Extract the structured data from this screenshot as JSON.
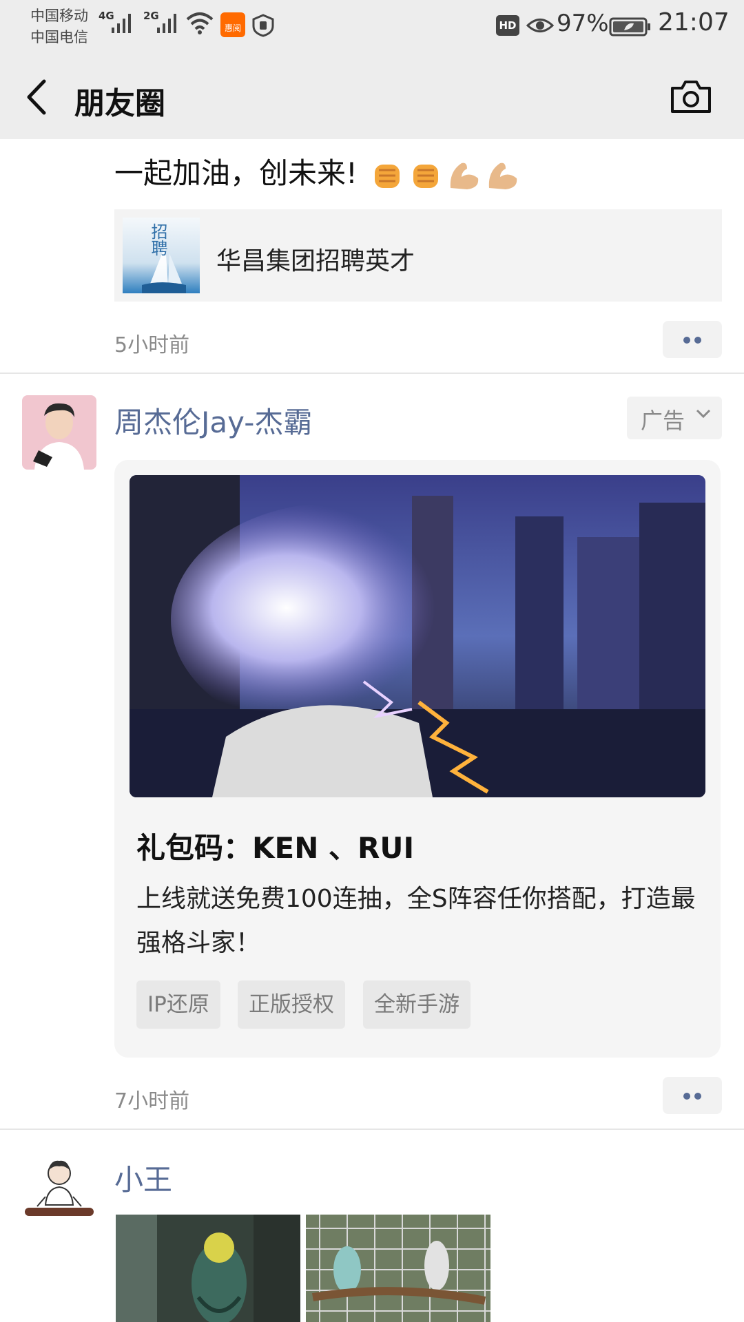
{
  "status_bar": {
    "carrier_1": "中国移动",
    "carrier_2": "中国电信",
    "net_1": "4G",
    "net_2": "2G",
    "app_badge": "惠阅",
    "hd": "HD",
    "battery_percent": "97%",
    "time": "21:07",
    "icons": [
      "signal-icon",
      "wifi-icon",
      "app-notification-icon",
      "shield-icon",
      "eye-icon",
      "battery-icon"
    ]
  },
  "nav": {
    "title": "朋友圈",
    "back_icon": "chevron-left-icon",
    "camera_icon": "camera-icon"
  },
  "posts": [
    {
      "text": "一起加油，创未来!",
      "emojis": [
        "fist-emoji",
        "fist-emoji",
        "flexed-biceps-emoji",
        "flexed-biceps-emoji"
      ],
      "link_card": {
        "thumb_text": "招聘",
        "title": "华昌集团招聘英才"
      },
      "time": "5小时前"
    },
    {
      "username": "周杰伦Jay-杰霸",
      "ad_tag": "广告",
      "headline": "礼包码：KEN 、RUI",
      "description": "上线就送免费100连抽，全S阵容任你搭配，打造最强格斗家！",
      "chips": [
        "IP还原",
        "正版授权",
        "全新手游"
      ],
      "time": "7小时前"
    },
    {
      "username": "小王"
    }
  ],
  "colors": {
    "bar_bg": "#ededed",
    "name_blue": "#576b95",
    "time_gray": "#8a8a8a",
    "card_bg": "#f5f5f5"
  }
}
